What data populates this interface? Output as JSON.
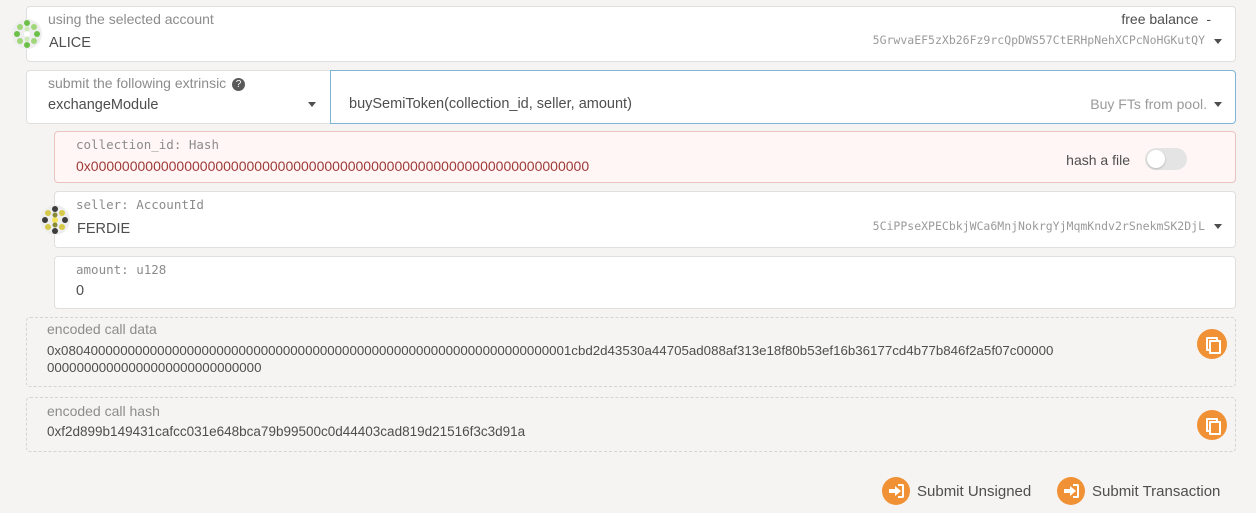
{
  "account": {
    "label": "using the selected account",
    "name": "ALICE",
    "balance_label": "free balance",
    "balance_value": "-",
    "address": "5GrwvaEF5zXb26Fz9rcQpDWS57CtERHpNehXCPcNoHGKutQY"
  },
  "extrinsic": {
    "label": "submit the following extrinsic",
    "help_icon": "?",
    "module": "exchangeModule",
    "method": "buySemiToken(collection_id, seller, amount)",
    "method_description": "Buy FTs from pool."
  },
  "params": {
    "collection_id": {
      "label": "collection_id: Hash",
      "value": "0x0000000000000000000000000000000000000000000000000000000000000000",
      "toggle_label": "hash a file"
    },
    "seller": {
      "label": "seller: AccountId",
      "name": "FERDIE",
      "address": "5CiPPseXPECbkjWCa6MnjNokrgYjMqmKndv2rSnekmSK2DjL"
    },
    "amount": {
      "label": "amount: u128",
      "value": "0"
    }
  },
  "encoded_call_data": {
    "label": "encoded call data",
    "line1": "0x080400000000000000000000000000000000000000000000000000000000000000001cbd2d43530a44705ad088af313e18f80b53ef16b36177cd4b77b846f2a5f07c00000",
    "line2": "00000000000000000000000000000"
  },
  "encoded_call_hash": {
    "label": "encoded call hash",
    "value": "0xf2d899b149431cafcc031e648bca79b99500c0d44403cad819d21516f3c3d91a"
  },
  "actions": {
    "submit_unsigned": "Submit Unsigned",
    "submit_transaction": "Submit Transaction"
  },
  "colors": {
    "accent": "#f19135",
    "error_bg": "#fff6f5",
    "error_border": "#e9c3c0",
    "error_text": "#9f3a38"
  }
}
